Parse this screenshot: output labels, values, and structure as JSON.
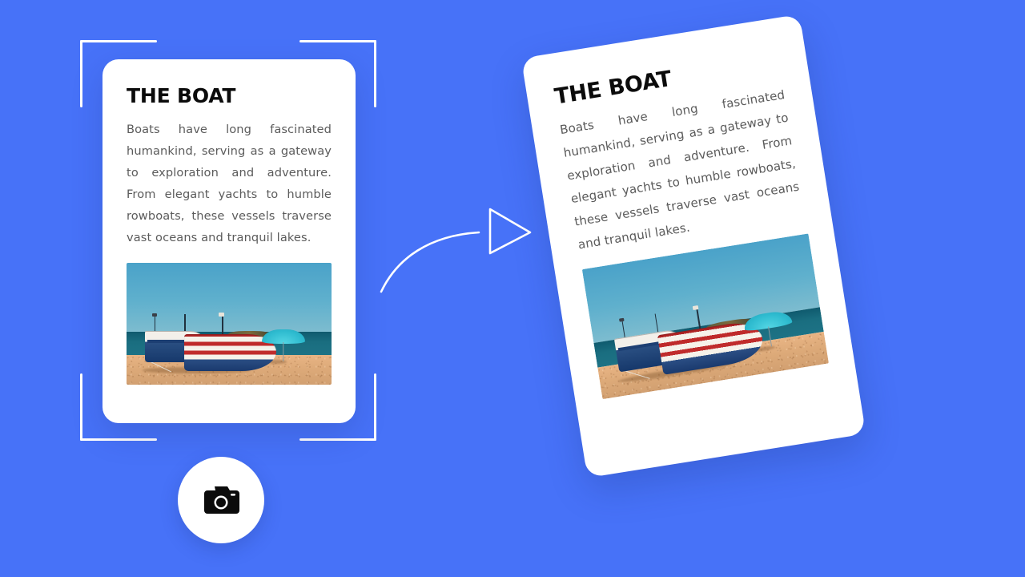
{
  "theme": {
    "background_color": "#4772f8",
    "card_color": "#ffffff",
    "title_color": "#0b0b0b",
    "body_text_color": "#5b5b5b",
    "frame_color": "#ffffff"
  },
  "cards": {
    "original": {
      "title": "THE BOAT",
      "body": "Boats have long fascinated humankind, serving as a gateway to exploration and adventure. From elegant yachts to humble rowboats, these vessels traverse vast oceans and tranquil lakes.",
      "photo_alt": "boats-on-beach-photo"
    },
    "tilted": {
      "title": "THE BOAT",
      "body": "Boats have long fascinated humankind, serving as a gateway to exploration and adventure. From elegant yachts to humble rowboats, these vessels traverse vast oceans and tranquil lakes.",
      "photo_alt": "boats-on-beach-photo",
      "rotation_degrees": -9
    }
  },
  "capture_frame": {
    "icon": "crop-brackets",
    "corners": [
      "top-left",
      "top-right",
      "bottom-left",
      "bottom-right"
    ]
  },
  "arrow": {
    "icon": "curved-arrow-right",
    "color": "#ffffff"
  },
  "camera_button": {
    "icon": "camera-icon",
    "label": "",
    "background": "#ffffff",
    "glyph_color": "#0b0b0b"
  },
  "photo_scene": {
    "sky_color": "#4aa2c9",
    "sea_color": "#1a6e80",
    "sand_color": "#ddaa79",
    "umbrella_color": "#2fbcd0",
    "boat_front_colors": [
      "#bf2a2a",
      "#f6f2ea",
      "#1a3a6e"
    ],
    "boat_rear_colors": [
      "#f3f0ea",
      "#1d3f73"
    ]
  }
}
